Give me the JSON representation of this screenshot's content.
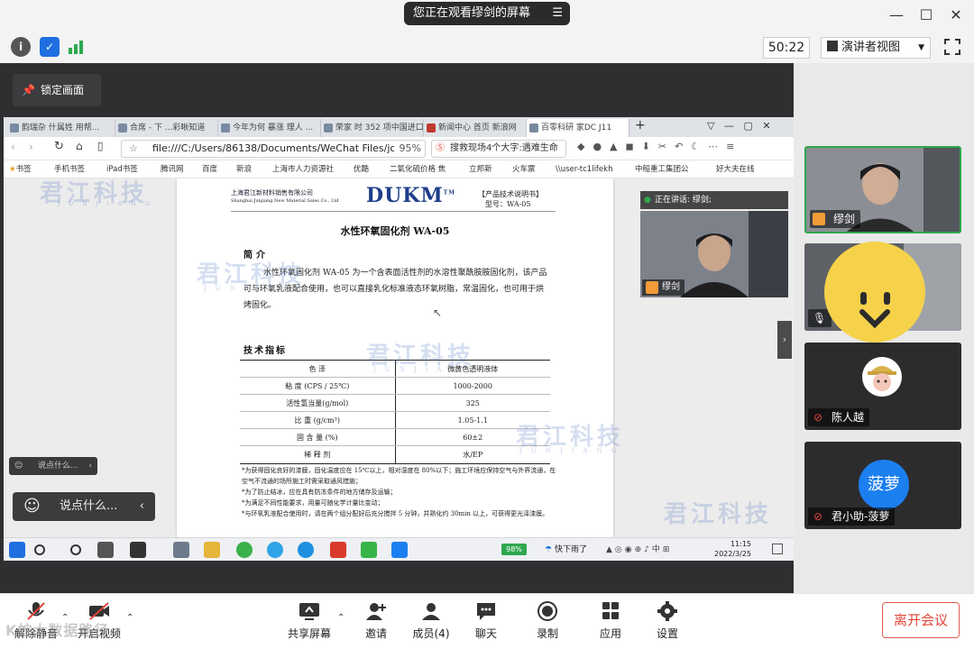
{
  "titlebar": {
    "sharing_notice": "您正在观看缪剑的屏幕",
    "menu_icon": "list-icon"
  },
  "toolbar2": {
    "timer": "50:22",
    "view_mode": "演讲者视图"
  },
  "main": {
    "lock_label": "锁定画面"
  },
  "browser": {
    "tabs": [
      "韵瑞杂 什属姓 用帮...",
      "合席 - 下 ...彩晰知道",
      "今年为何 暴涨 理人 ...",
      "荣家 时 352 项中国进口...",
      "新闻中心 首页 新浪网",
      "百零科研 家DC J11"
    ],
    "url": "file:///C:/Users/86138/Documents/WeChat Files/joe",
    "zoom": "95%",
    "search_text": "搜救现场4个大字:遇难生命",
    "bookmarks": [
      "书签",
      "手机书签",
      "iPad书签",
      "腾讯网",
      "百度",
      "新浪",
      "上海市人力资源社",
      "优酷",
      "二氧化硫价格 焦",
      "立邦新",
      "火车票",
      "\\\\user-tc1lifekh",
      "中船重工集团公",
      "好大夫在线"
    ]
  },
  "doc": {
    "company_cn": "上海君江新材料销售有限公司",
    "company_en": "Shanghai Junjiang New Material Sales Co., Ltd",
    "brand": "DUKM",
    "brand_tm": "TM",
    "tag1": "【产品技术说明书】",
    "tag2": "型号：WA-05",
    "title": "水性环氧固化剂 WA-05",
    "intro_heading": "简介",
    "intro_text": "水性环氧固化剂 WA-05 为一个含表面活性剂的水溶性聚酰胺胺固化剂，该产品可与环氧乳液配合使用，也可以直接乳化标准液态环氧树脂，常温固化，也可用于烘烤固化。",
    "spec_heading": "技术指标",
    "specs": [
      {
        "name": "色 泽",
        "value": "微黄色透明液体"
      },
      {
        "name": "粘 度 (CPS / 25℃)",
        "value": "1000-2000"
      },
      {
        "name": "活性氢当量(g/mol)",
        "value": "325"
      },
      {
        "name": "比 重 (g/cm³)",
        "value": "1.05-1.1"
      },
      {
        "name": "固 含 量 (%)",
        "value": "60±2"
      },
      {
        "name": "稀 释 剂",
        "value": "水/EP"
      }
    ],
    "notes": [
      "*为获得固化良好的漆膜，固化温度应在 15℃以上，相对湿度在 80%以下；施工环境应保持空气与外界流通，在空气不流通的场所施工时需采取通风措施；",
      "*为了防止结冰，应在具有防冻条件的地方储存及运输；",
      "*为满足不同性能要求，用量可随化学计量比变动；",
      "*与环氧乳液配合使用时，请在两个组分配好后充分搅拌 5 分钟，并熟化约 30min 以上，可获得更光泽漆膜。"
    ],
    "watermark": "君江科技",
    "watermark_sub": "JUNJIANG"
  },
  "speaker_mini": {
    "speaking_label": "正在讲话: 缪剑;",
    "name": "缪剑"
  },
  "taskbar": {
    "battery": "98%",
    "weather": "快下雨了",
    "time": "11:15",
    "date": "2022/3/25"
  },
  "chat": {
    "small": "说点什么...",
    "big": "说点什么..."
  },
  "participants": [
    {
      "name": "缪剑",
      "mic": "on"
    },
    {
      "name": "",
      "mic": "on"
    },
    {
      "name": "陈人越",
      "mic": "muted"
    },
    {
      "name": "君小助-菠萝",
      "mic": "muted",
      "avatar_text": "菠萝"
    }
  ],
  "bottom": {
    "mute": "解除静音",
    "video": "开启视频",
    "share": "共享屏幕",
    "invite": "邀请",
    "members": "成员(4)",
    "chat": "聊天",
    "record": "录制",
    "apps": "应用",
    "settings": "设置",
    "leave": "离开会议",
    "overlay_watermark": "K蛇大数据路径"
  },
  "colors": {
    "accent_green": "#2fa84f",
    "leave_red": "#e0463a",
    "avatar_blue": "#1c7ff0",
    "speaking_orange": "#f29b38"
  }
}
